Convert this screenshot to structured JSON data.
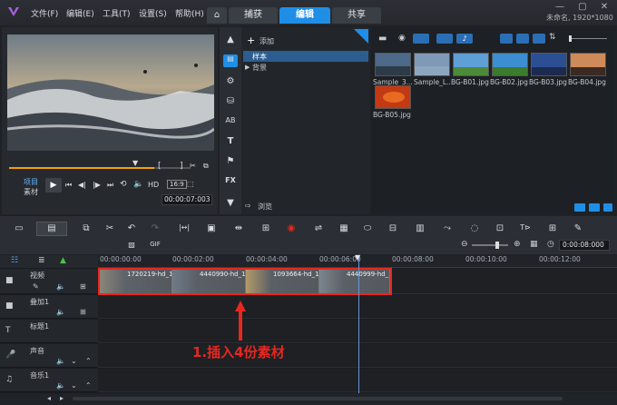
{
  "menu": {
    "file": "文件(F)",
    "edit": "编辑(E)",
    "tools": "工具(T)",
    "settings": "设置(S)",
    "help": "帮助(H)"
  },
  "tabs": {
    "capture": "捕获",
    "edit": "编辑",
    "share": "共享"
  },
  "project_info": "未命名, 1920*1080",
  "preview": {
    "mode_project": "项目",
    "mode_clip": "素材",
    "hd": "HD",
    "timecode": "00:00:07:003"
  },
  "library": {
    "add_label": "添加",
    "tree_items": [
      "样本",
      "背景"
    ],
    "browse_label": "浏览",
    "thumbnails": [
      {
        "caption": "Sample_3...",
        "color": "#4d6a8a"
      },
      {
        "caption": "Sample_L...",
        "color": "#7f9ab6"
      },
      {
        "caption": "BG-B01.jpg",
        "color": "#5e9fd6"
      },
      {
        "caption": "BG-B02.jpg",
        "color": "#3d8ed0"
      },
      {
        "caption": "BG-B03.jpg",
        "color": "#2c4f94"
      },
      {
        "caption": "BG-B04.jpg",
        "color": "#cf8a5a"
      },
      {
        "caption": "BG-B05.jpg",
        "color": "#c23a14"
      }
    ]
  },
  "toolbar2": {
    "zoom_timecode": "0:00:08:000"
  },
  "ruler": [
    "00:00:00:00",
    "00:00:02:00",
    "00:00:04:00",
    "00:00:06:00",
    "00:00:08:00",
    "00:00:10:00",
    "00:00:12:00"
  ],
  "tracks": [
    "视频",
    "叠加1",
    "标题1",
    "声音",
    "音乐1"
  ],
  "clips": [
    "1720219-hd_19",
    "4440990-hd_19",
    "1093664-hd_19",
    "4440999-hd_19"
  ],
  "annotation": "1.插入4份素材",
  "colors": {
    "accent": "#1f8ee6",
    "annotation": "#e8271f"
  }
}
